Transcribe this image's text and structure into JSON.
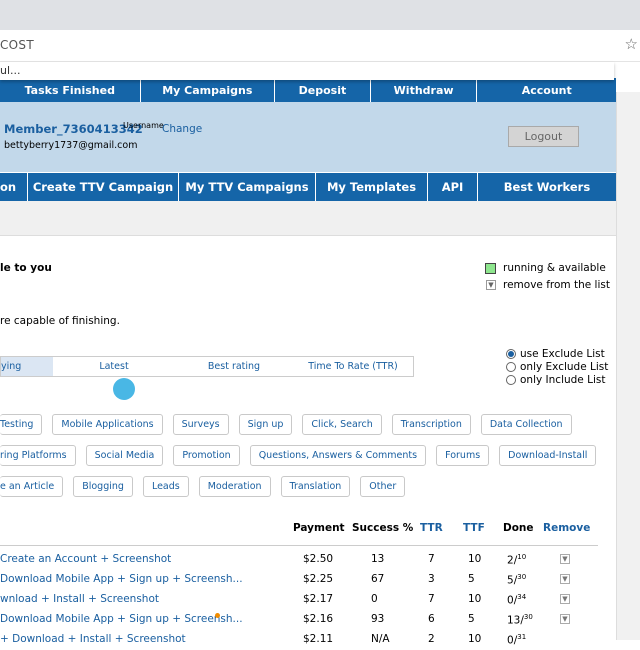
{
  "browser": {
    "url_fragment": "COST",
    "dropdown_fragment": "ul..."
  },
  "top_nav": [
    "Tasks Finished",
    "My Campaigns",
    "Deposit",
    "Withdraw",
    "Account"
  ],
  "user": {
    "username": "Member_7360413342",
    "username_label": "Username",
    "change_label": "Change",
    "email": "bettyberry1737@gmail.com",
    "logout_label": "Logout"
  },
  "main_nav": [
    "on",
    "Create TTV Campaign",
    "My TTV Campaigns",
    "My Templates",
    "API",
    "Best Workers"
  ],
  "section": {
    "heading": "le to you",
    "description": "re capable of finishing."
  },
  "legend": {
    "running_label": "running & available",
    "remove_label": "remove from the list"
  },
  "sort_tabs": [
    "ying",
    "Latest",
    "Best rating",
    "Time To Rate (TTR)"
  ],
  "filter_options": [
    {
      "label": "use Exclude List",
      "selected": true
    },
    {
      "label": "only Exclude List",
      "selected": false
    },
    {
      "label": "only Include List",
      "selected": false
    }
  ],
  "tags": {
    "row1": [
      "Testing",
      "Mobile Applications",
      "Surveys",
      "Sign up",
      "Click, Search",
      "Transcription",
      "Data Collection"
    ],
    "row2": [
      "ring Platforms",
      "Social Media",
      "Promotion",
      "Questions, Answers & Comments",
      "Forums",
      "Download-Install"
    ],
    "row3": [
      "e an Article",
      "Blogging",
      "Leads",
      "Moderation",
      "Translation",
      "Other"
    ]
  },
  "table": {
    "headers": {
      "payment": "Payment",
      "success": "Success %",
      "ttr": "TTR",
      "ttf": "TTF",
      "done": "Done",
      "remove": "Remove"
    },
    "rows": [
      {
        "name": "Create an Account + Screenshot",
        "payment": "$2.50",
        "success": "13",
        "ttr": "7",
        "ttf": "10",
        "done": "2",
        "total": "10",
        "flag": false
      },
      {
        "name": "Download Mobile App + Sign up + Screensh...",
        "payment": "$2.25",
        "success": "67",
        "ttr": "3",
        "ttf": "5",
        "done": "5",
        "total": "30",
        "flag": false
      },
      {
        "name": "wnload + Install + Screenshot",
        "payment": "$2.17",
        "success": "0",
        "ttr": "7",
        "ttf": "10",
        "done": "0",
        "total": "34",
        "flag": false
      },
      {
        "name": "Download Mobile App + Sign up + Screensh...",
        "payment": "$2.16",
        "success": "93",
        "ttr": "6",
        "ttf": "5",
        "done": "13",
        "total": "30",
        "flag": true
      },
      {
        "name": "+ Download + Install + Screenshot",
        "payment": "$2.11",
        "success": "N/A",
        "ttr": "2",
        "ttf": "10",
        "done": "0",
        "total": "31",
        "flag": false
      }
    ]
  },
  "colors": {
    "nav_blue": "#1565a8",
    "panel_blue": "#c2d8ea",
    "link_blue": "#1a5fa0",
    "legend_green": "#8ee68e",
    "flag_orange": "#f08c00"
  }
}
